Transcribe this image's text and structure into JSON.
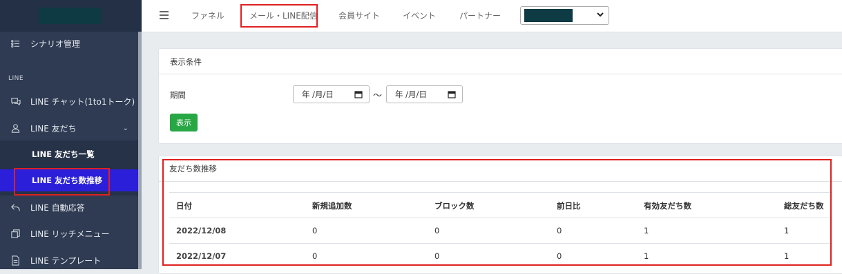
{
  "topnav": {
    "items": [
      {
        "label": "ファネル"
      },
      {
        "label": "メール・LINE配信"
      },
      {
        "label": "会員サイト"
      },
      {
        "label": "イベント"
      },
      {
        "label": "パートナー"
      }
    ]
  },
  "sidebar": {
    "scenario_label": "シナリオ管理",
    "section_line": "LINE",
    "items": [
      {
        "label": "LINE チャット(1to1トーク)",
        "icon": "chat-icon"
      },
      {
        "label": "LINE 友だち",
        "icon": "user-icon"
      },
      {
        "label": "LINE 自動応答",
        "icon": "reply-icon"
      },
      {
        "label": "LINE リッチメニュー",
        "icon": "copy-icon"
      },
      {
        "label": "LINE テンプレート",
        "icon": "file-icon"
      }
    ],
    "sub_items": [
      {
        "label": "LINE 友だち一覧"
      },
      {
        "label": "LINE 友だち数推移"
      }
    ]
  },
  "filter": {
    "title": "表示条件",
    "period_label": "期間",
    "date_from": "年 /月/日",
    "date_to": "年 /月/日",
    "tilde": "〜",
    "show_button": "表示"
  },
  "stats": {
    "title": "友だち数推移",
    "columns": [
      "日付",
      "新規追加数",
      "ブロック数",
      "前日比",
      "有効友だち数",
      "総友だち数"
    ],
    "rows": [
      [
        "2022/12/08",
        "0",
        "0",
        "0",
        "1",
        "1"
      ],
      [
        "2022/12/07",
        "0",
        "0",
        "0",
        "1",
        "1"
      ]
    ]
  },
  "colors": {
    "sidebar_bg": "#2e3b52",
    "active_item_bg": "#2b1fd9",
    "highlight_border": "#e02020",
    "show_button_bg": "#28a745"
  }
}
